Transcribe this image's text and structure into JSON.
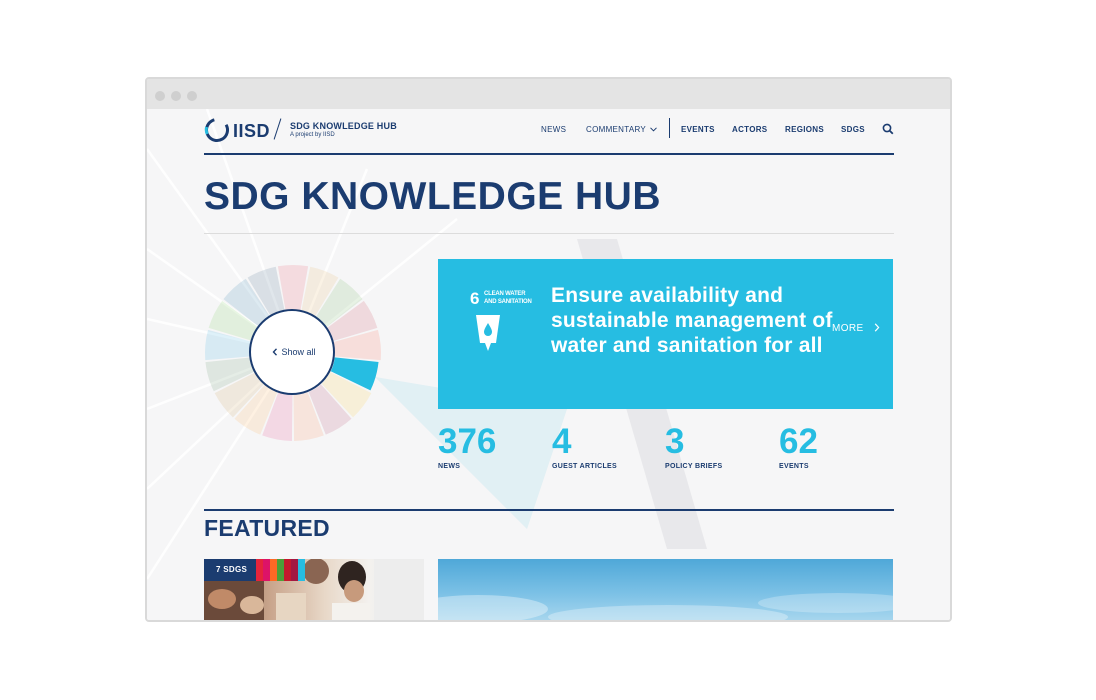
{
  "header": {
    "logo_text": "IISD",
    "site_name": "SDG KNOWLEDGE HUB",
    "site_sub": "A project by IISD",
    "nav": {
      "news": "NEWS",
      "commentary": "COMMENTARY",
      "events": "EVENTS",
      "actors": "ACTORS",
      "regions": "REGIONS",
      "sdgs": "SDGS"
    },
    "icons": {
      "dropdown": "chevron-down-icon",
      "search": "search-icon"
    }
  },
  "page": {
    "title": "SDG KNOWLEDGE HUB"
  },
  "wheel": {
    "show_all_label": "Show all",
    "selected_goal": 6,
    "colors": [
      "#e5243b",
      "#dda63a",
      "#4c9f38",
      "#c5192d",
      "#ff3a21",
      "#26bde2",
      "#fcc30b",
      "#a21942",
      "#fd6925",
      "#dd1367",
      "#fd9d24",
      "#bf8b2e",
      "#3f7e44",
      "#0a97d9",
      "#56c02b",
      "#00689d",
      "#19486a"
    ]
  },
  "goal": {
    "number": "6",
    "tag_line1": "CLEAN WATER",
    "tag_line2": "AND SANITATION",
    "heading": "Ensure availability and sustainable management of water and sanitation for all",
    "more_label": "MORE",
    "color": "#26bde2"
  },
  "stats": [
    {
      "value": "376",
      "label": "NEWS"
    },
    {
      "value": "4",
      "label": "GUEST ARTICLES"
    },
    {
      "value": "3",
      "label": "POLICY BRIEFS"
    },
    {
      "value": "62",
      "label": "EVENTS"
    }
  ],
  "featured": {
    "title": "FEATURED",
    "card1": {
      "badge": "7 SDGS",
      "strip_colors": [
        "#e5243b",
        "#dd1367",
        "#fd6925",
        "#4c9f38",
        "#c5192d",
        "#a21942",
        "#26bde2"
      ]
    }
  },
  "colors": {
    "brand_navy": "#1b3c70",
    "accent_cyan": "#26bde2",
    "page_bg": "#f6f6f7"
  }
}
